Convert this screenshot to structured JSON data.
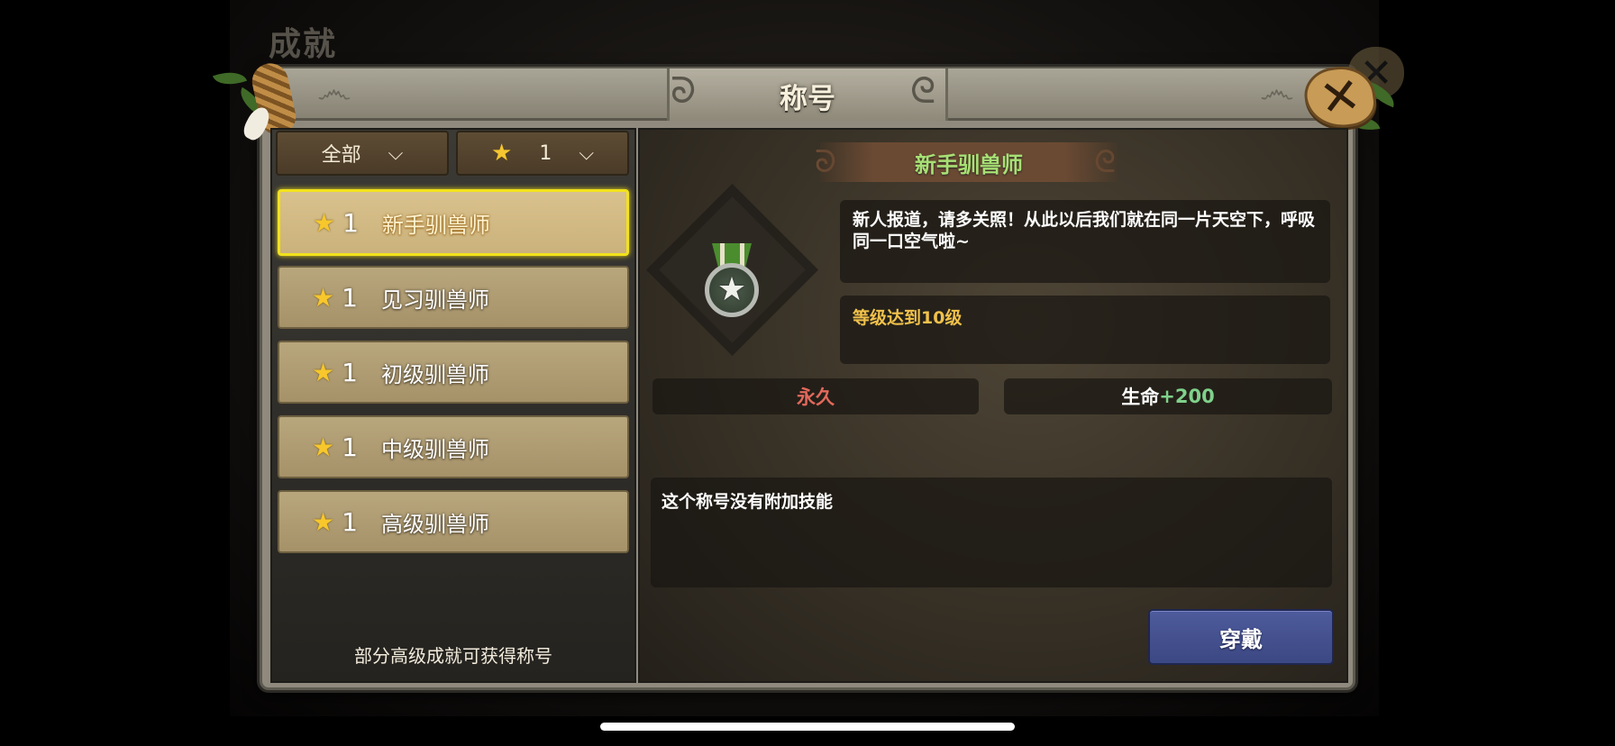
{
  "background": {
    "title": "成就"
  },
  "dialog": {
    "title": "称号",
    "close_icon": "close-x-icon",
    "filters": {
      "category": {
        "label": "全部",
        "icon": "chevron-down-icon"
      },
      "star_filter": {
        "value": "1",
        "icon": "star-icon",
        "chevron": "chevron-down-icon"
      }
    },
    "titles": [
      {
        "star_icon": "star-icon",
        "level": "1",
        "name": "新手驯兽师",
        "selected": true
      },
      {
        "star_icon": "star-icon",
        "level": "1",
        "name": "见习驯兽师",
        "selected": false
      },
      {
        "star_icon": "star-icon",
        "level": "1",
        "name": "初级驯兽师",
        "selected": false
      },
      {
        "star_icon": "star-icon",
        "level": "1",
        "name": "中级驯兽师",
        "selected": false
      },
      {
        "star_icon": "star-icon",
        "level": "1",
        "name": "高级驯兽师",
        "selected": false
      }
    ],
    "footer_note": "部分高级成就可获得称号",
    "detail": {
      "name": "新手驯兽师",
      "emblem_icon": "star-medal-icon",
      "description": "新人报道，请多关照！从此以后我们就在同一片天空下，呼吸同一口空气啦~",
      "requirement": "等级达到10级",
      "duration": "永久",
      "stat_label": "生命",
      "stat_bonus": "+200",
      "skill_text": "这个称号没有附加技能",
      "equip_label": "穿戴"
    },
    "colors": {
      "selected_border": "#f2e21c",
      "title_green": "#a8e074",
      "requirement_gold": "#f0c14b",
      "duration_red": "#e2695c",
      "bonus_green": "#7fd18b",
      "equip_blue": "#4e5b9c"
    }
  }
}
